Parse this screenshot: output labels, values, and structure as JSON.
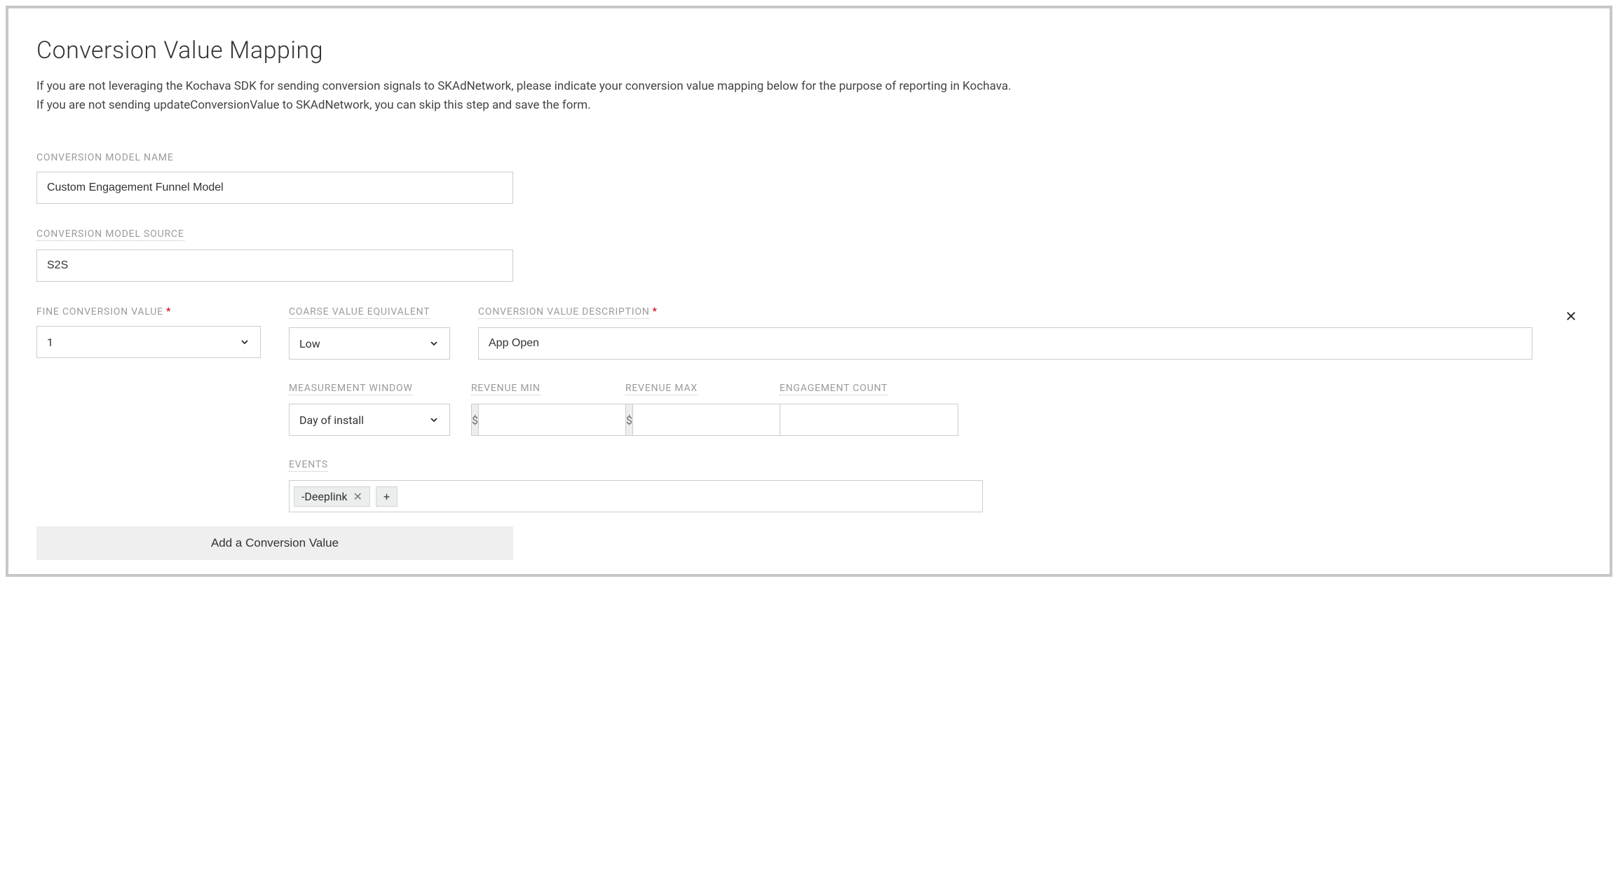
{
  "title": "Conversion Value Mapping",
  "intro": "If you are not leveraging the Kochava SDK for sending conversion signals to SKAdNetwork, please indicate your conversion value mapping below for the purpose of reporting in Kochava. If you are not sending updateConversionValue to SKAdNetwork, you can skip this step and save the form.",
  "labels": {
    "model_name": "CONVERSION MODEL NAME",
    "model_source": "CONVERSION MODEL SOURCE",
    "fine": "FINE CONVERSION VALUE",
    "coarse": "COARSE VALUE EQUIVALENT",
    "desc": "CONVERSION VALUE DESCRIPTION",
    "window": "MEASUREMENT WINDOW",
    "rev_min": "REVENUE MIN",
    "rev_max": "REVENUE MAX",
    "eng": "ENGAGEMENT COUNT",
    "events": "EVENTS"
  },
  "values": {
    "model_name": "Custom Engagement Funnel Model",
    "model_source": "S2S",
    "fine": "1",
    "coarse": "Low",
    "desc": "App Open",
    "window": "Day of install",
    "rev_min": "",
    "rev_max": "",
    "eng": "",
    "currency": "$"
  },
  "events": {
    "chips": [
      {
        "label": "-Deeplink"
      }
    ],
    "add": "+"
  },
  "add_button": "Add a Conversion Value",
  "required_marker": "*"
}
